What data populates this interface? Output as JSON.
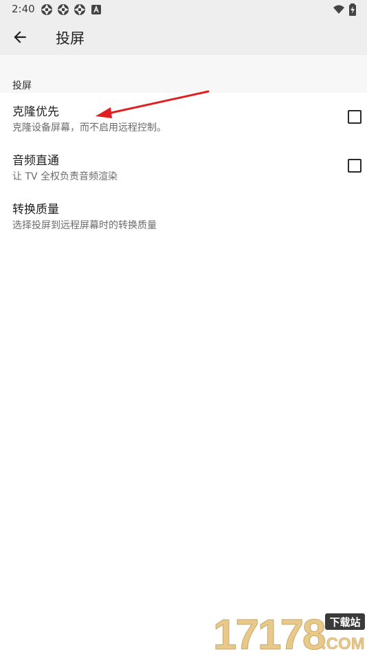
{
  "status_bar": {
    "time": "2:40",
    "notification_icons": [
      "aperture-icon",
      "aperture-icon",
      "aperture-icon",
      "a-badge-icon"
    ],
    "system_icons": [
      "wifi-icon",
      "battery-charging-icon"
    ]
  },
  "app_bar": {
    "title": "投屏"
  },
  "section": {
    "header": "投屏"
  },
  "preferences": [
    {
      "title": "克隆优先",
      "summary": "克隆设备屏幕，而不启用远程控制。",
      "checked": false
    },
    {
      "title": "音频直通",
      "summary": "让 TV 全权负责音频渲染",
      "checked": false
    },
    {
      "title": "转换质量",
      "summary": "选择投屏到远程屏幕时的转换质量"
    }
  ],
  "watermark": {
    "number": "17178",
    "badge": "下载站",
    "domain": ".COM"
  },
  "colors": {
    "bar_background": "#eeeeee",
    "annotation_arrow": "#e02020",
    "watermark_gold": "#e8c98a",
    "watermark_badge": "#3a3a3a"
  }
}
